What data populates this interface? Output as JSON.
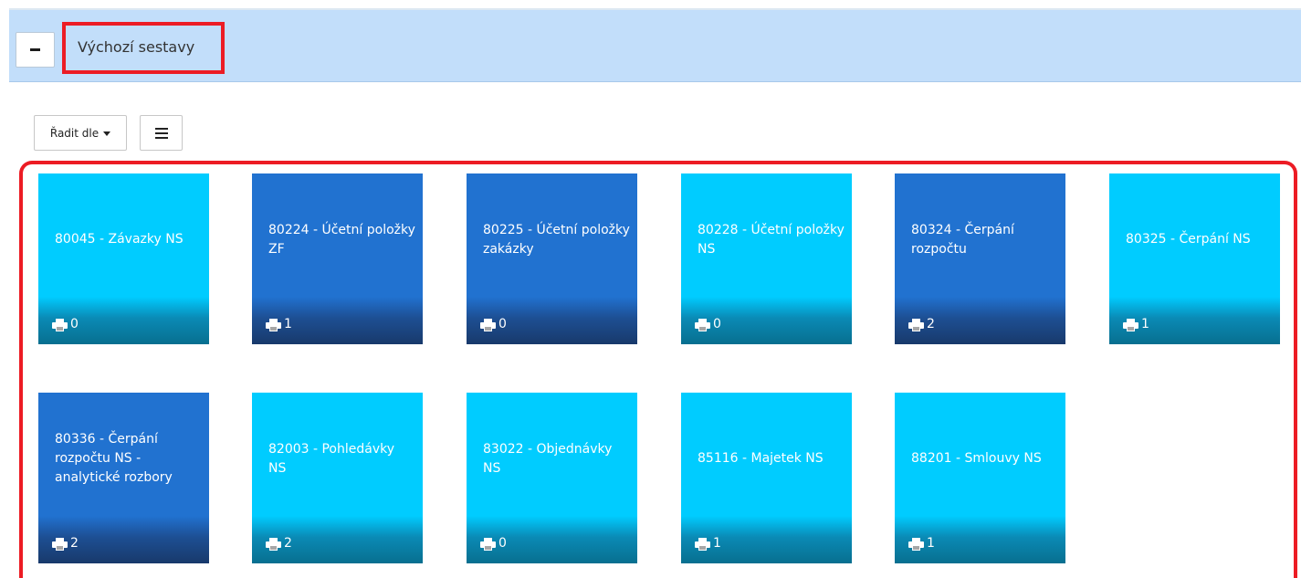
{
  "section": {
    "title": "Výchozí sestavy"
  },
  "toolbar": {
    "sort_label": "Řadit dle"
  },
  "tiles": [
    {
      "label": "80045 - Závazky NS",
      "count": "0",
      "color": "#00ccff"
    },
    {
      "label": "80224 - Účetní položky ZF",
      "count": "1",
      "color": "#2172d0"
    },
    {
      "label": "80225 - Účetní položky zakázky",
      "count": "0",
      "color": "#2172d0"
    },
    {
      "label": "80228 - Účetní položky NS",
      "count": "0",
      "color": "#00ccff"
    },
    {
      "label": "80324 - Čerpání rozpočtu",
      "count": "2",
      "color": "#2172d0"
    },
    {
      "label": "80325 - Čerpání NS",
      "count": "1",
      "color": "#00ccff"
    },
    {
      "label": "80336 - Čerpání rozpočtu NS - analytické rozbory",
      "count": "2",
      "color": "#2172d0"
    },
    {
      "label": "82003 - Pohledávky NS",
      "count": "2",
      "color": "#00ccff"
    },
    {
      "label": "83022 - Objednávky NS",
      "count": "0",
      "color": "#00ccff"
    },
    {
      "label": "85116 - Majetek NS",
      "count": "1",
      "color": "#00ccff"
    },
    {
      "label": "88201 - Smlouvy NS",
      "count": "1",
      "color": "#00ccff"
    }
  ],
  "icons": {
    "collapse": "minus-icon",
    "sort": "caret-down-icon",
    "view": "list-icon",
    "print": "printer-icon"
  }
}
